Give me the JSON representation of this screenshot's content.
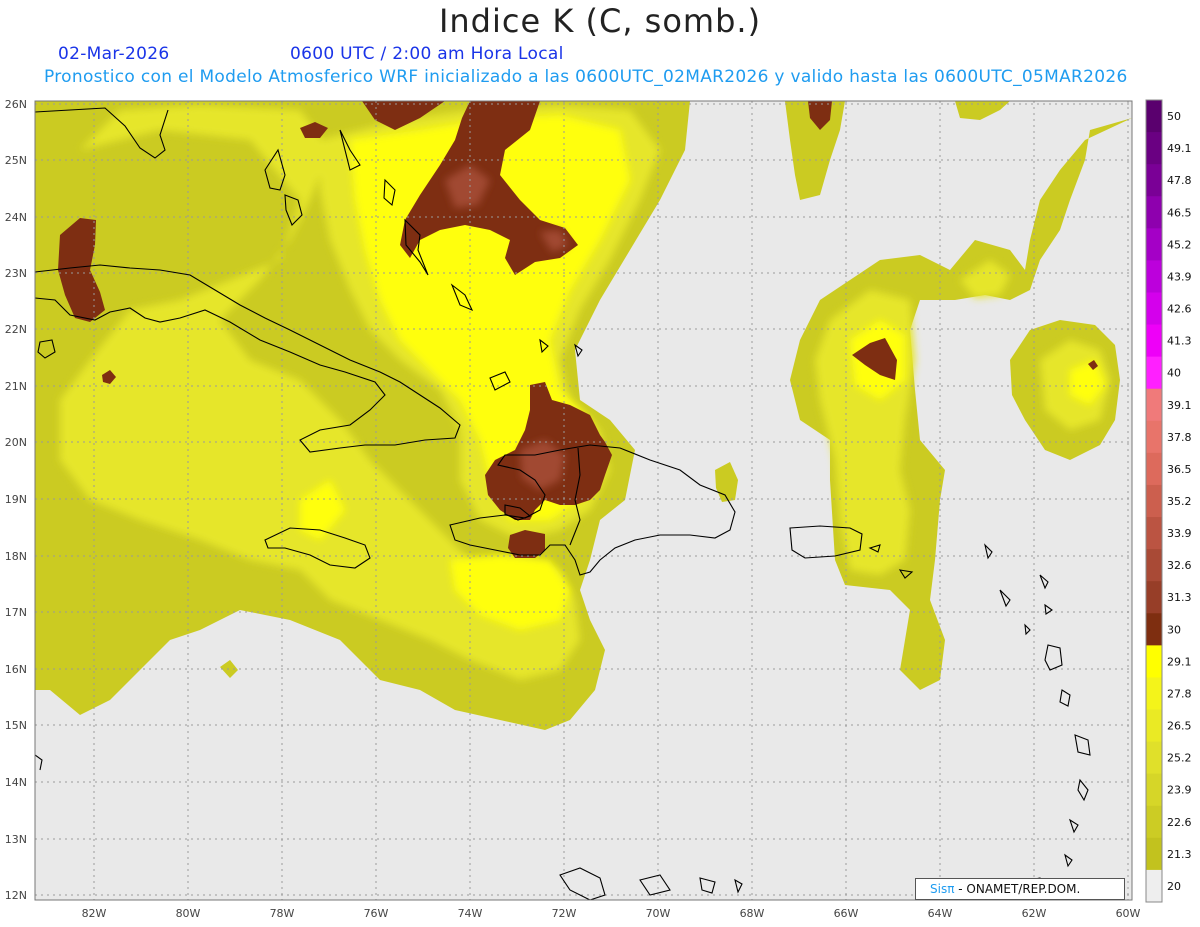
{
  "header": {
    "title": "Indice K (C, somb.)",
    "date": "02-Mar-2026",
    "time": "0600 UTC / 2:00 am Hora Local",
    "model_line": "Pronostico con el Modelo Atmosferico WRF inicializado a las 0600UTC_02MAR2026 y valido hasta las  0600UTC_05MAR2026"
  },
  "map": {
    "lat_labels": [
      "26N",
      "25N",
      "24N",
      "23N",
      "22N",
      "21N",
      "20N",
      "19N",
      "18N",
      "17N",
      "16N",
      "15N",
      "14N",
      "13N",
      "12N"
    ],
    "lon_labels": [
      "82W",
      "80W",
      "78W",
      "76W",
      "74W",
      "72W",
      "70W",
      "68W",
      "66W",
      "64W",
      "62W",
      "60W"
    ],
    "lat_range": [
      11.8,
      26.1
    ],
    "lon_range": [
      -83.2,
      -59.8
    ],
    "background_color": "#e9e9e9"
  },
  "colorbar": {
    "labels": [
      "50",
      "49.1",
      "47.8",
      "46.5",
      "45.2",
      "43.9",
      "42.6",
      "41.3",
      "40",
      "39.1",
      "37.8",
      "36.5",
      "35.2",
      "33.9",
      "32.6",
      "31.3",
      "30",
      "29.1",
      "27.8",
      "26.5",
      "25.2",
      "23.9",
      "22.6",
      "21.3",
      "20"
    ],
    "colors": [
      "#5a006e",
      "#6a0082",
      "#7a0096",
      "#8e00ae",
      "#a400c6",
      "#bc00dc",
      "#d400ec",
      "#ee00f8",
      "#ff20ff",
      "#f07a7a",
      "#e8746a",
      "#dd6a5c",
      "#cc5f4e",
      "#bb5442",
      "#a94a36",
      "#973e28",
      "#7e2e10",
      "#ffff00",
      "#f4f41a",
      "#eaea24",
      "#e0e02a",
      "#d6d628",
      "#cccc24",
      "#c2c21e",
      "#eeeeee"
    ]
  },
  "credit": {
    "brand": "Sisπ",
    "org": " -  ONAMET/REP.DOM."
  }
}
